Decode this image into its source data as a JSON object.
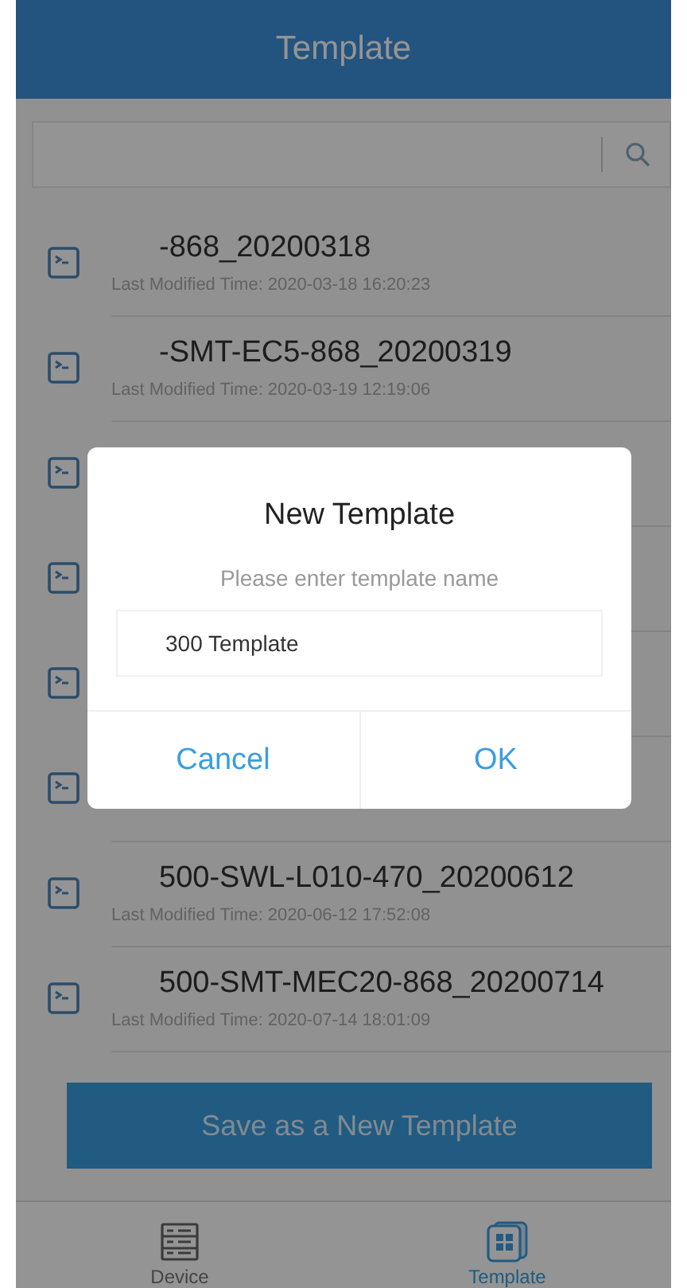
{
  "header": {
    "title": "Template"
  },
  "templates": [
    {
      "kind": "row",
      "title": "-868_20200318",
      "modified": "Last Modified Time: 2020-03-18 16:20:23"
    },
    {
      "kind": "row",
      "title": "-SMT-EC5-868_20200319",
      "modified": "Last Modified Time: 2020-03-19 12:19:06"
    },
    {
      "kind": "covered"
    },
    {
      "kind": "covered"
    },
    {
      "kind": "covered"
    },
    {
      "kind": "covered"
    },
    {
      "kind": "row",
      "title": "500-SWL-L010-470_20200612",
      "modified": "Last Modified Time: 2020-06-12 17:52:08"
    },
    {
      "kind": "row",
      "title": "500-SMT-MEC20-868_20200714",
      "modified": "Last Modified Time: 2020-07-14 18:01:09"
    }
  ],
  "save_button": "Save as a  New Template",
  "bottom_nav": [
    {
      "label": "Device",
      "kind": "device",
      "selected": false
    },
    {
      "label": "Template",
      "kind": "template",
      "selected": true
    }
  ],
  "dialog": {
    "title": "New Template",
    "message": "Please enter template name",
    "value": "300 Template",
    "buttons": [
      "Cancel",
      "OK"
    ]
  }
}
